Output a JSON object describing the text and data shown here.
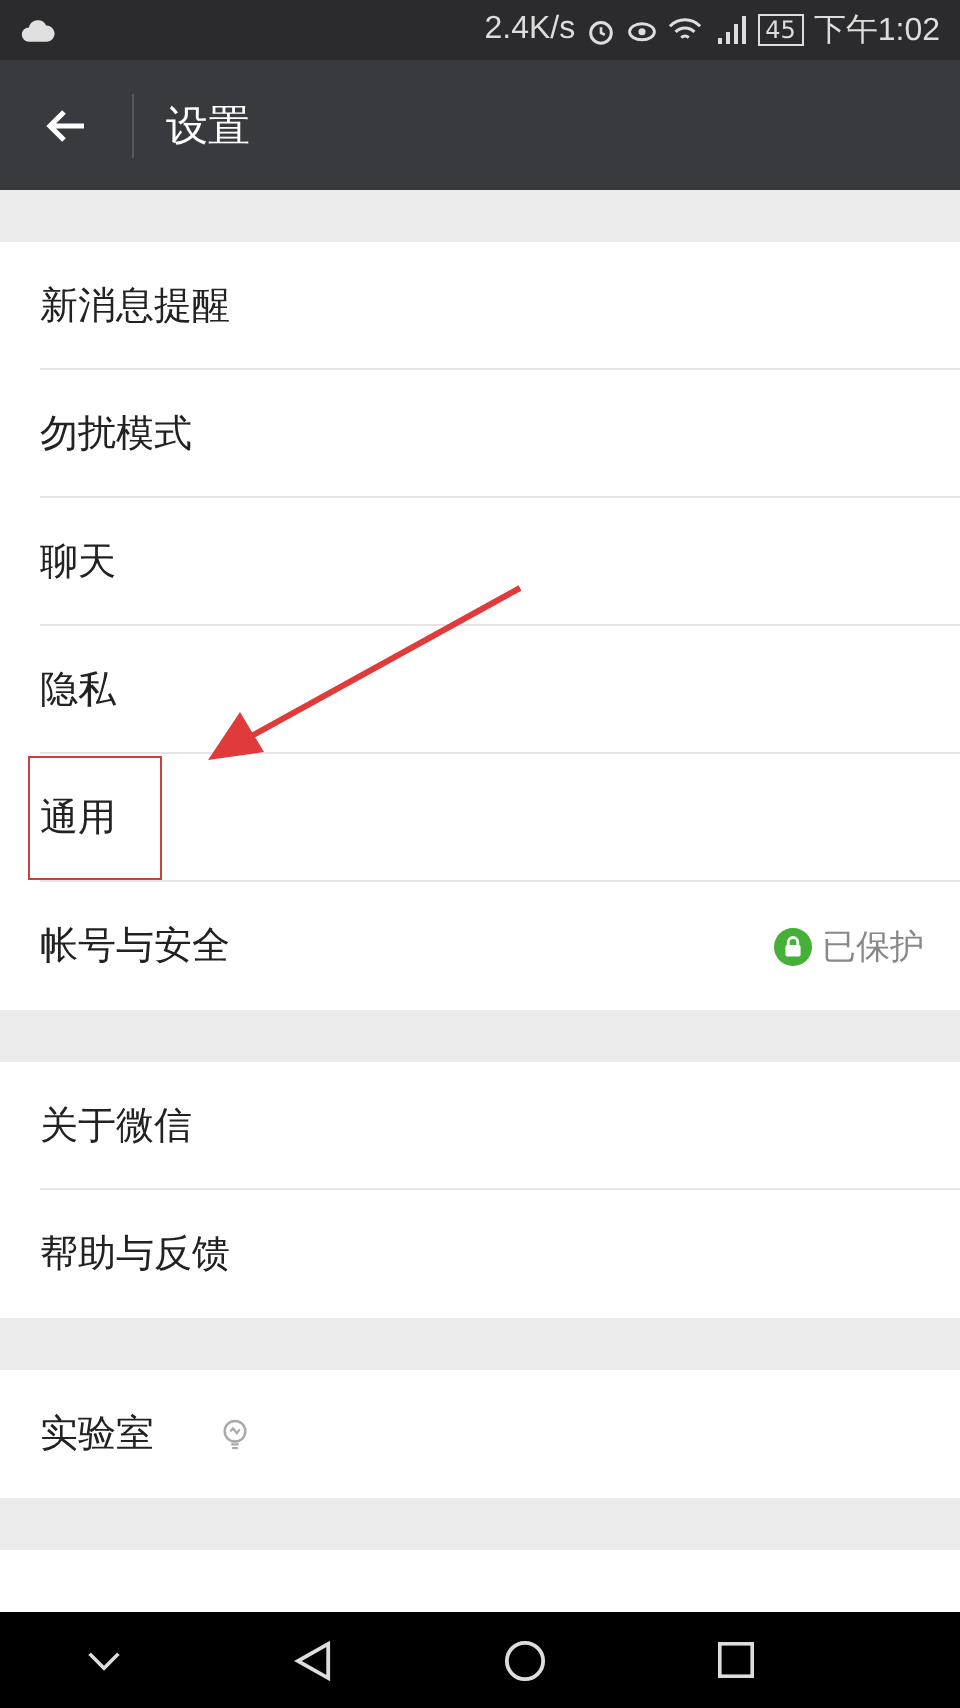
{
  "status_bar": {
    "speed": "2.4K/s",
    "battery": "45",
    "time": "下午1:02"
  },
  "header": {
    "title": "设置"
  },
  "groups": [
    {
      "items": [
        {
          "label": "新消息提醒",
          "highlighted": false
        },
        {
          "label": "勿扰模式",
          "highlighted": false
        },
        {
          "label": "聊天",
          "highlighted": false
        },
        {
          "label": "隐私",
          "highlighted": false
        },
        {
          "label": "通用",
          "highlighted": true
        },
        {
          "label": "帐号与安全",
          "highlighted": false,
          "status": "已保护"
        }
      ]
    },
    {
      "items": [
        {
          "label": "关于微信",
          "highlighted": false
        },
        {
          "label": "帮助与反馈",
          "highlighted": false
        }
      ]
    },
    {
      "items": [
        {
          "label": "实验室",
          "highlighted": false,
          "kind": "lab"
        }
      ]
    }
  ]
}
